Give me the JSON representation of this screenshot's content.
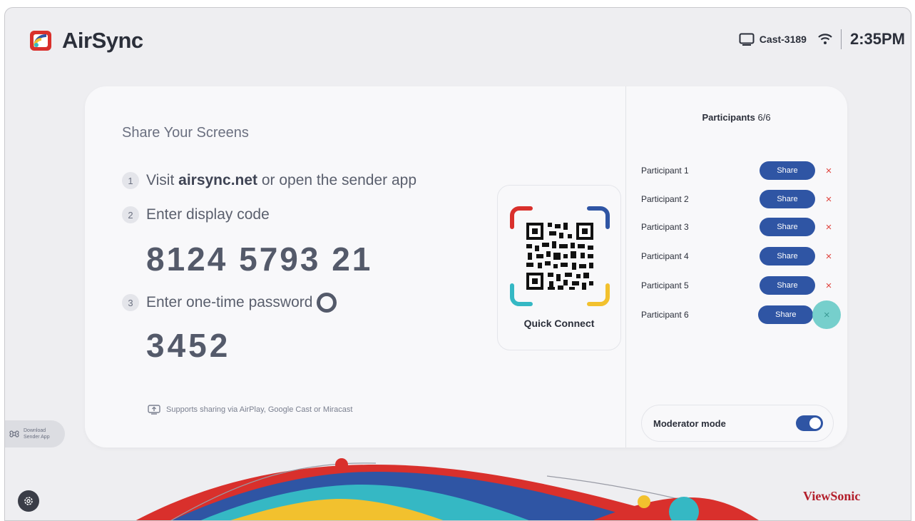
{
  "header": {
    "app_name": "AirSync",
    "cast_name": "Cast-3189",
    "time": "2:35PM",
    "icons": [
      "airsync-logo-icon",
      "display-icon",
      "wifi-icon"
    ]
  },
  "share": {
    "title": "Share Your Screens",
    "steps": [
      {
        "number": "1",
        "prefix": "Visit ",
        "bold": "airsync.net",
        "suffix": " or open the sender app"
      },
      {
        "number": "2",
        "text": "Enter display code"
      },
      {
        "number": "3",
        "text": "Enter one-time password"
      }
    ],
    "display_code": "8124 5793 21",
    "one_time_password": "3452",
    "supports": "Supports sharing via AirPlay, Google Cast or Miracast"
  },
  "qr": {
    "label": "Quick Connect",
    "corner_colors": [
      "#d9302c",
      "#2f55a4",
      "#35b8c4",
      "#f2c12e"
    ]
  },
  "participants": {
    "title": "Participants",
    "count": "6/6",
    "share_label": "Share",
    "close_symbol": "×",
    "items": [
      {
        "name": "Participant 1"
      },
      {
        "name": "Participant 2"
      },
      {
        "name": "Participant 3"
      },
      {
        "name": "Participant 4"
      },
      {
        "name": "Participant 5"
      },
      {
        "name": "Participant 6"
      }
    ]
  },
  "moderator": {
    "label": "Moderator mode",
    "enabled": true
  },
  "side_tab": {
    "line1": "Download",
    "line2": "Sender App"
  },
  "footer": {
    "brand": "ViewSonic",
    "settings_icon": "gear-icon"
  },
  "colors": {
    "accent": "#2f55a4",
    "close": "#e0443e",
    "brand": "#b31e2b"
  }
}
